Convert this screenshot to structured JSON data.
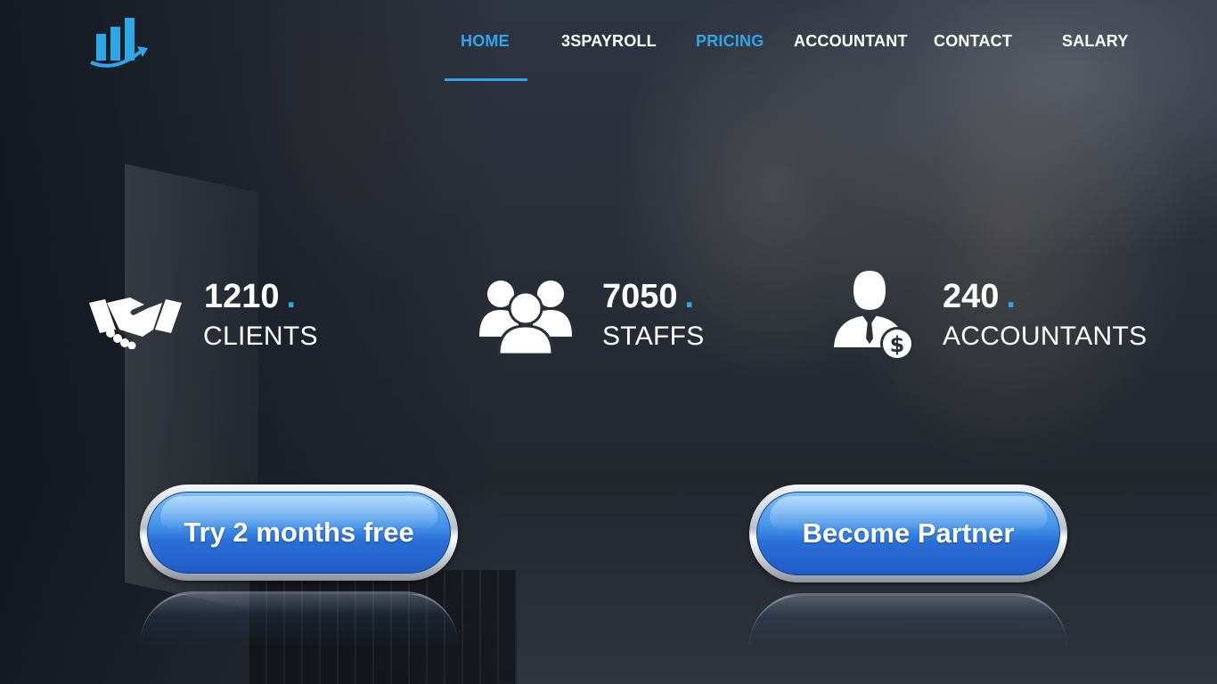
{
  "brand": {
    "logo": "bar-chart-growth-logo",
    "accent_color": "#2fa6e8"
  },
  "nav": {
    "items": [
      {
        "label": "HOME",
        "active": true
      },
      {
        "label": "3SPAYROLL",
        "active": false
      },
      {
        "label": "PRICING",
        "active": false
      },
      {
        "label": "ACCOUNTANT",
        "active": false
      },
      {
        "label": "CONTACT",
        "active": false
      },
      {
        "label": "SALARY",
        "active": false
      }
    ]
  },
  "stats": [
    {
      "icon": "handshake-icon",
      "number": "1210",
      "dot": ".",
      "label": "CLIENTS"
    },
    {
      "icon": "users-group-icon",
      "number": "7050",
      "dot": ".",
      "label": "STAFFS"
    },
    {
      "icon": "accountant-dollar-icon",
      "number": "240",
      "dot": ".",
      "label": "ACCOUNTANTS"
    }
  ],
  "cta": {
    "trial_label": "Try 2 months free",
    "partner_label": "Become Partner",
    "button_color": "#2b6fd6"
  }
}
